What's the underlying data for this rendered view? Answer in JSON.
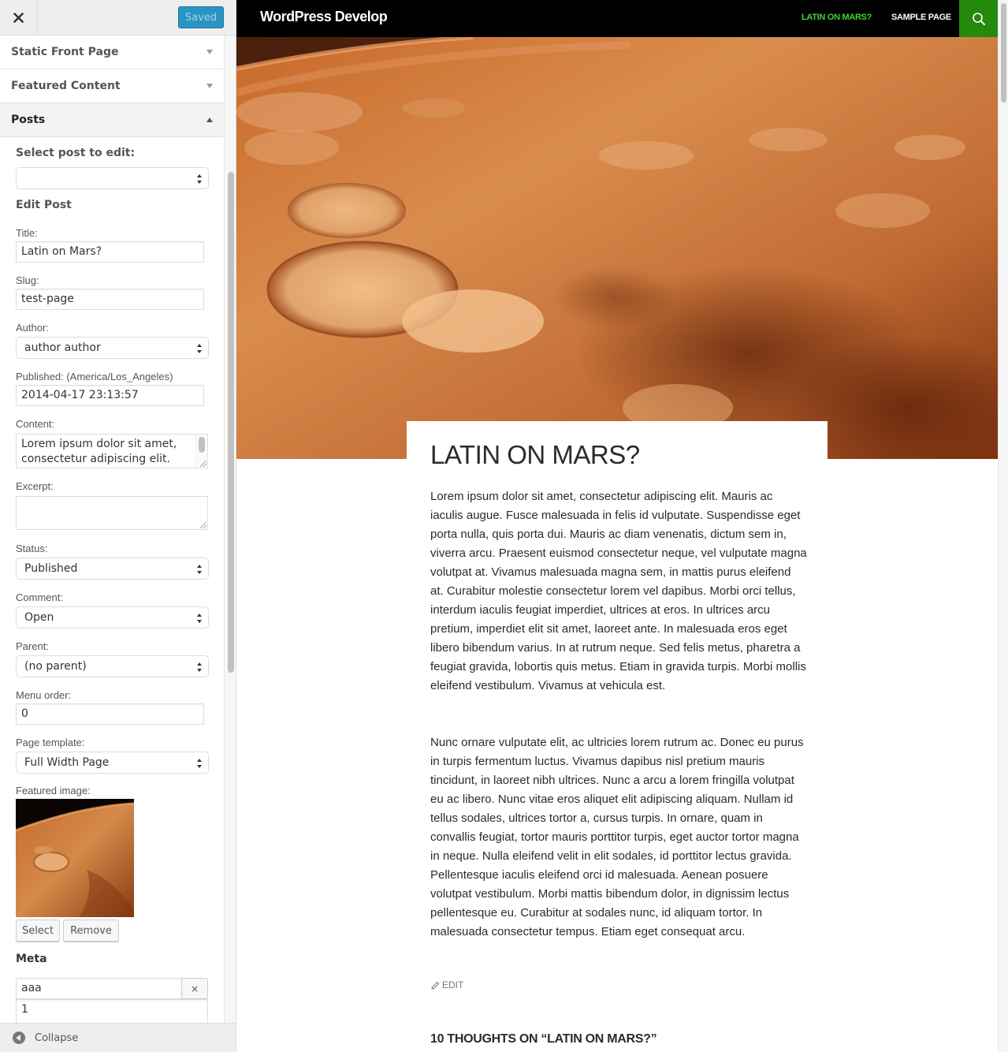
{
  "customizer": {
    "close_icon": "close-icon",
    "save_button": "Saved",
    "sections": [
      {
        "label": "Static Front Page",
        "state": "collapsed"
      },
      {
        "label": "Featured Content",
        "state": "collapsed"
      },
      {
        "label": "Posts",
        "state": "expanded"
      }
    ],
    "posts": {
      "select_post_label": "Select post to edit:",
      "select_post_value": "",
      "edit_post_heading": "Edit Post",
      "title_label": "Title:",
      "title_value": "Latin on Mars?",
      "slug_label": "Slug:",
      "slug_value": "test-page",
      "author_label": "Author:",
      "author_value": "author author",
      "published_label": "Published: (America/Los_Angeles)",
      "published_value": "2014-04-17 23:13:57",
      "content_label": "Content:",
      "content_value": "Lorem ipsum dolor sit amet, consectetur adipiscing elit.",
      "excerpt_label": "Excerpt:",
      "excerpt_value": "",
      "status_label": "Status:",
      "status_value": "Published",
      "comment_label": "Comment:",
      "comment_value": "Open",
      "parent_label": "Parent:",
      "parent_value": "(no parent)",
      "menu_order_label": "Menu order:",
      "menu_order_value": "0",
      "page_template_label": "Page template:",
      "page_template_value": "Full Width Page",
      "featured_image_label": "Featured image:",
      "select_button": "Select",
      "remove_button": "Remove",
      "meta_heading": "Meta",
      "meta_key_value": "aaa",
      "meta_remove_button": "×",
      "meta_value_value": "1"
    },
    "collapse_label": "Collapse"
  },
  "preview": {
    "site_title": "WordPress Develop",
    "nav": [
      {
        "label": "LATIN ON MARS?",
        "current": true
      },
      {
        "label": "SAMPLE PAGE",
        "current": false
      }
    ],
    "search_icon": "search-icon",
    "post": {
      "title": "LATIN ON MARS?",
      "paragraphs": [
        "Lorem ipsum dolor sit amet, consectetur adipiscing elit. Mauris ac iaculis augue. Fusce malesuada in felis id vulputate. Suspendisse eget porta nulla, quis porta dui. Mauris ac diam venenatis, dictum sem in, viverra arcu. Praesent euismod consectetur neque, vel vulputate magna volutpat at. Vivamus malesuada magna sem, in mattis purus eleifend at. Curabitur molestie consectetur lorem vel dapibus. Morbi orci tellus, interdum iaculis feugiat imperdiet, ultrices at eros. In ultrices arcu pretium, imperdiet elit sit amet, laoreet ante. In malesuada eros eget libero bibendum varius. In at rutrum neque. Sed felis metus, pharetra a feugiat gravida, lobortis quis metus. Etiam in gravida turpis. Morbi mollis eleifend vestibulum. Vivamus at vehicula est.",
        "Nunc ornare vulputate elit, ac ultricies lorem rutrum ac. Donec eu purus in turpis fermentum luctus. Vivamus dapibus nisl pretium mauris tincidunt, in laoreet nibh ultrices. Nunc a arcu a lorem fringilla volutpat eu ac libero. Nunc vitae eros aliquet elit adipiscing aliquam. Nullam id tellus sodales, ultrices tortor a, cursus turpis. In ornare, quam in convallis feugiat, tortor mauris porttitor turpis, eget auctor tortor magna in neque. Nulla eleifend velit in elit sodales, id porttitor lectus gravida. Pellentesque iaculis eleifend orci id malesuada. Aenean posuere volutpat vestibulum. Morbi mattis bibendum dolor, in dignissim lectus pellentesque eu. Curabitur at sodales nunc, id aliquam tortor. In malesuada consectetur tempus. Etiam eget consequat arcu."
      ],
      "edit_link": "EDIT",
      "comments_title": "10 THOUGHTS ON “LATIN ON MARS?”"
    }
  },
  "colors": {
    "accent_green": "#24890d",
    "nav_current": "#41d430",
    "save_button": "#2a95c5",
    "masthead": "#000000"
  }
}
